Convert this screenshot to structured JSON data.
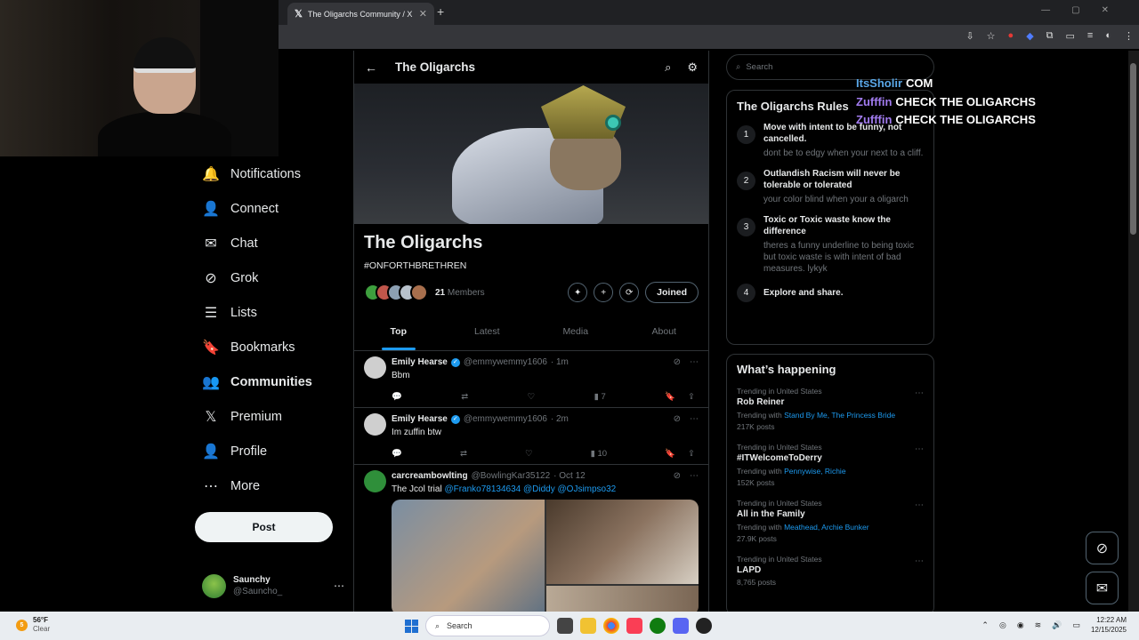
{
  "browser": {
    "tab_title": "The Oligarchs Community / X",
    "tab_close": "✕",
    "new_tab": "+"
  },
  "nav": {
    "items": [
      {
        "label": "Notifications",
        "icon": "bell-icon",
        "glyph": "🔔"
      },
      {
        "label": "Connect",
        "icon": "person-add-icon",
        "glyph": "👤"
      },
      {
        "label": "Chat",
        "icon": "mail-icon",
        "glyph": "✉"
      },
      {
        "label": "Grok",
        "icon": "grok-icon",
        "glyph": "⊘"
      },
      {
        "label": "Lists",
        "icon": "list-icon",
        "glyph": "☰"
      },
      {
        "label": "Bookmarks",
        "icon": "bookmark-icon",
        "glyph": "🔖"
      },
      {
        "label": "Communities",
        "icon": "communities-icon",
        "glyph": "👥",
        "active": true
      },
      {
        "label": "Premium",
        "icon": "x-logo-icon",
        "glyph": "𝕏"
      },
      {
        "label": "Profile",
        "icon": "profile-icon",
        "glyph": "👤"
      },
      {
        "label": "More",
        "icon": "more-icon",
        "glyph": "⋯"
      }
    ],
    "post_label": "Post"
  },
  "account": {
    "name": "Saunchy",
    "handle": "@Sauncho_"
  },
  "header": {
    "title": "The Oligarchs"
  },
  "community": {
    "name": "The Oligarchs",
    "hashtag": "#ONFORTHBRETHREN",
    "member_count": "21",
    "members_label": "Members",
    "joined_label": "Joined"
  },
  "tabs": [
    "Top",
    "Latest",
    "Media",
    "About"
  ],
  "posts": [
    {
      "name": "Emily Hearse",
      "handle": "@emmywemmy1606",
      "time": "· 1m",
      "text": "Bbm",
      "views": "7",
      "verified": true
    },
    {
      "name": "Emily Hearse",
      "handle": "@emmywemmy1606",
      "time": "· 2m",
      "text": "Im zuffin btw",
      "views": "10",
      "verified": true
    },
    {
      "name": "carcreambowlting",
      "handle": "@BowlingKar35122",
      "time": "· Oct 12",
      "text": "The Jcol trial",
      "mentions": "@Franko78134634 @Diddy @OJsimpso32"
    }
  ],
  "search": {
    "placeholder": "Search"
  },
  "rules": {
    "title": "The Oligarchs Rules",
    "items": [
      {
        "num": "1",
        "title": "Move with intent to be funny, not cancelled.",
        "desc": "dont be to edgy when your next to a cliff."
      },
      {
        "num": "2",
        "title": "Outlandish Racism will never be tolerable or tolerated",
        "desc": "your color blind when your a oligarch"
      },
      {
        "num": "3",
        "title": "Toxic or Toxic waste know the difference",
        "desc": "theres a funny underline to being toxic but toxic waste is with intent of bad measures. lykyk"
      },
      {
        "num": "4",
        "title": "Explore and share.",
        "desc": ""
      }
    ]
  },
  "trending": {
    "title": "What’s happening",
    "items": [
      {
        "context": "Trending in United States",
        "name": "Rob Reiner",
        "with_label": "Trending with",
        "with": "Stand By Me, The Princess Bride",
        "count": "217K posts"
      },
      {
        "context": "Trending in United States",
        "name": "#ITWelcomeToDerry",
        "with_label": "Trending with",
        "with": "Pennywise, Richie",
        "count": "152K posts"
      },
      {
        "context": "Trending in United States",
        "name": "All in the Family",
        "with_label": "Trending with",
        "with": "Meathead, Archie Bunker",
        "count": "27.9K posts"
      },
      {
        "context": "Trending in United States",
        "name": "LAPD",
        "with_label": "",
        "with": "",
        "count": "8,765 posts"
      }
    ]
  },
  "overlay_chat": [
    {
      "user": "ItsSholir",
      "message": "COM",
      "color": "#5aa7e8"
    },
    {
      "user": "Zufffin",
      "message": "CHECK THE OLIGARCHS",
      "color": "#a27cf0"
    },
    {
      "user": "Zufffin",
      "message": "CHECK THE OLIGARCHS",
      "color": "#a27cf0"
    }
  ],
  "taskbar": {
    "temperature": "56°F",
    "condition": "Clear",
    "weather_badge": "5",
    "search_label": "Search",
    "time": "12:22 AM",
    "date": "12/15/2025"
  },
  "colors": {
    "accent": "#1d9bf0",
    "background": "#000000"
  }
}
